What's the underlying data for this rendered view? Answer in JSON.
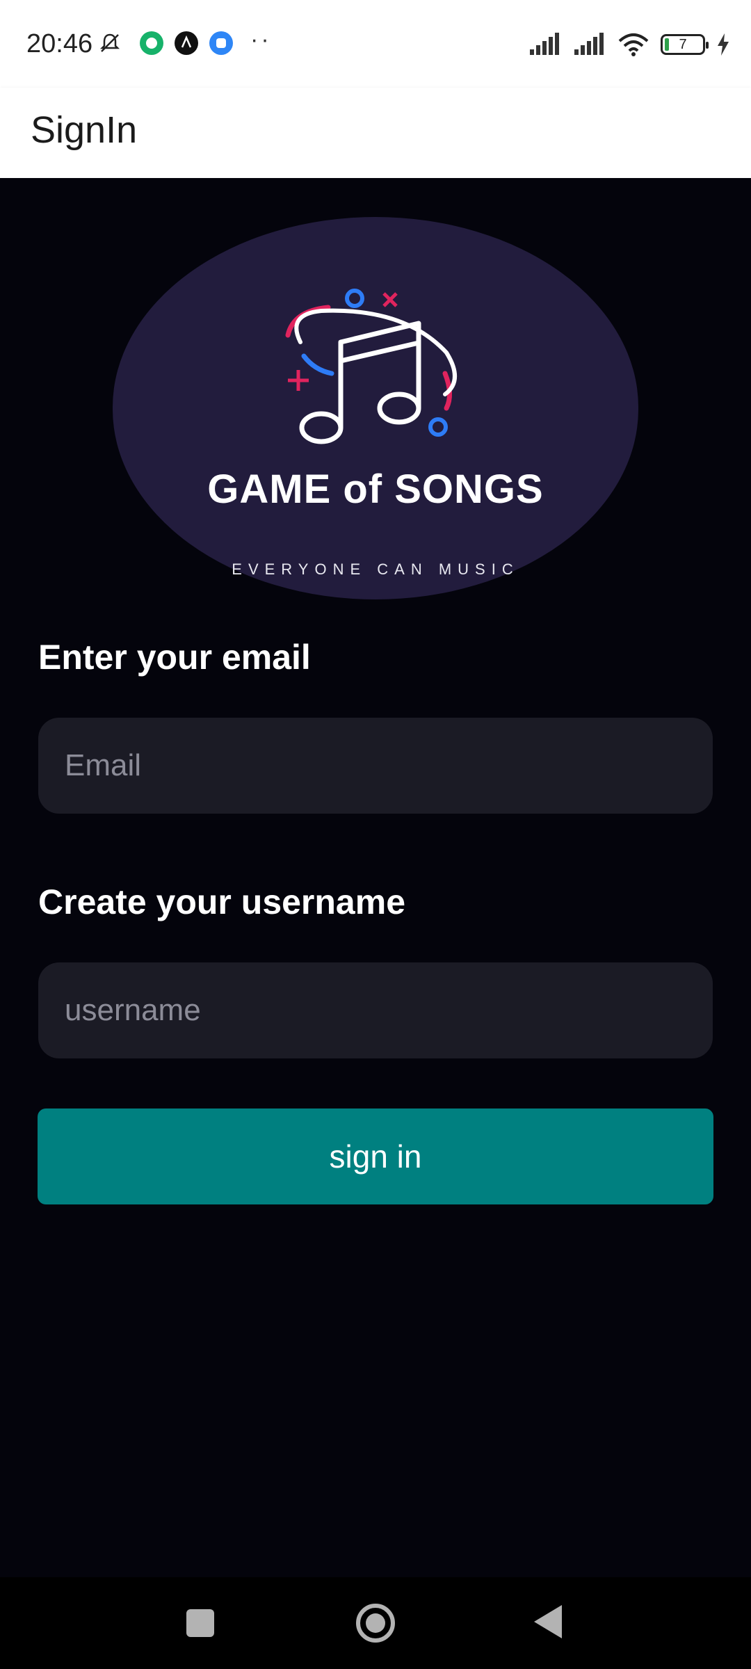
{
  "status_bar": {
    "time": "20:46",
    "battery_level": "7",
    "icons": [
      "mute-icon",
      "app-icon-green",
      "app-icon-black",
      "app-icon-blue",
      "more-dots-icon",
      "signal-icon",
      "signal-icon-2",
      "wifi-icon",
      "battery-icon",
      "charging-icon"
    ],
    "more_dots": "··"
  },
  "app_bar": {
    "title": "SignIn"
  },
  "logo": {
    "name": "GAME of SONGS",
    "tagline": "EVERYONE CAN MUSIC",
    "colors": {
      "background": "#221c3d",
      "blue": "#2e7cf6",
      "red": "#e0245e"
    }
  },
  "form": {
    "email_label": "Enter your email",
    "email_placeholder": "Email",
    "email_value": "",
    "username_label": "Create your username",
    "username_placeholder": "username",
    "username_value": "",
    "submit_label": "sign in"
  },
  "colors": {
    "accent": "#008080",
    "background": "#04040c",
    "input_bg": "#1b1b25"
  },
  "nav": {
    "icons": [
      "recents-square-icon",
      "home-circle-icon",
      "back-triangle-icon"
    ]
  }
}
